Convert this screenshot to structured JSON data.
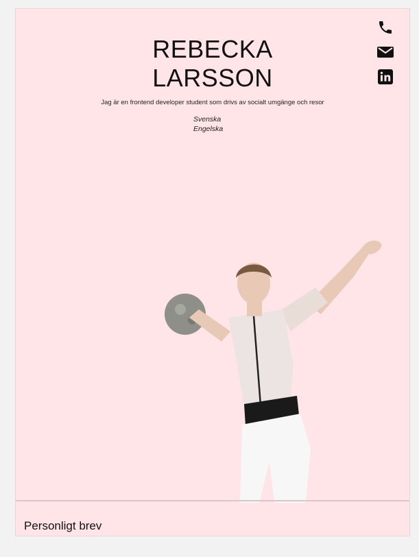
{
  "profile": {
    "name": "REBECKA\nLARSSON",
    "tagline": "Jag är en frontend developer student som drivs av socialt umgänge och resor",
    "languages": [
      "Svenska",
      "Engelska"
    ]
  },
  "contact_icons": [
    "phone-icon",
    "mail-icon",
    "linkedin-icon"
  ],
  "sections": {
    "personal_letter_title": "Personligt brev"
  },
  "colors": {
    "page_background": "#ffe4e8",
    "outer_background": "#f2f2f2",
    "text": "#111111"
  }
}
